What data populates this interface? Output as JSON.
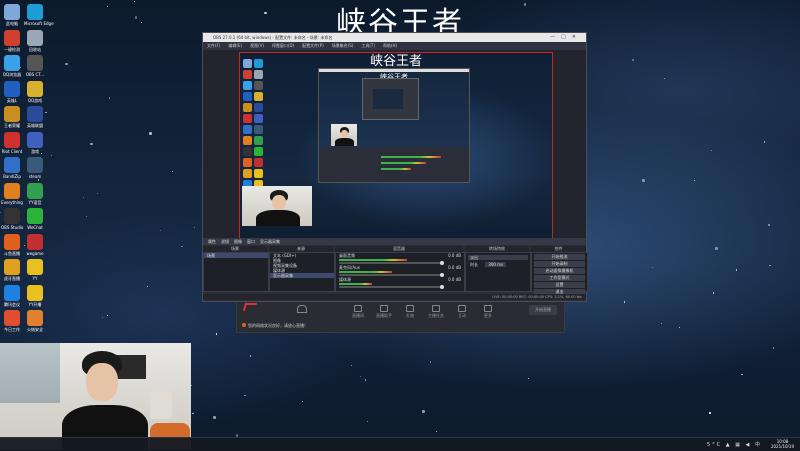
{
  "page_title": "峡谷王者",
  "desktop_icons": [
    {
      "label": "此电脑",
      "color": "#7fa7d8",
      "icon": "computer-icon"
    },
    {
      "label": "Microsoft Edge",
      "color": "#1f9bd8",
      "icon": "edge-icon"
    },
    {
      "label": "一键检测",
      "color": "#d04030",
      "icon": "tool-icon"
    },
    {
      "label": "回收站",
      "color": "#9aa7b4",
      "icon": "recycle-bin-icon"
    },
    {
      "label": "QQ浏览器",
      "color": "#3aa0e8",
      "icon": "qq-browser-icon"
    },
    {
      "label": "OBS CT...",
      "color": "#555",
      "icon": "obs-icon"
    },
    {
      "label": "英雄L",
      "color": "#2060c0",
      "icon": "game-icon"
    },
    {
      "label": "QQ游戏",
      "color": "#d8b030",
      "icon": "qq-game-icon"
    },
    {
      "label": "王者荣耀",
      "color": "#c89020",
      "icon": "game-icon"
    },
    {
      "label": "英雄联盟",
      "color": "#2a4a9a",
      "icon": "lol-icon"
    },
    {
      "label": "Riot Client",
      "color": "#d03030",
      "icon": "riot-icon"
    },
    {
      "label": "游戏",
      "color": "#4060c0",
      "icon": "game-icon"
    },
    {
      "label": "BandiZip",
      "color": "#3070c8",
      "icon": "zip-icon"
    },
    {
      "label": "steam",
      "color": "#3a5a7a",
      "icon": "steam-icon"
    },
    {
      "label": "Everything",
      "color": "#e08020",
      "icon": "search-icon"
    },
    {
      "label": "YY语音",
      "color": "#30a050",
      "icon": "yy-icon"
    },
    {
      "label": "OBS Studio",
      "color": "#333",
      "icon": "obs-icon"
    },
    {
      "label": "WeChat",
      "color": "#2db33a",
      "icon": "wechat-icon"
    },
    {
      "label": "斗鱼直播",
      "color": "#e06020",
      "icon": "douyu-icon"
    },
    {
      "label": "wegame",
      "color": "#c03030",
      "icon": "wegame-icon"
    },
    {
      "label": "虎牙直播",
      "color": "#e0a020",
      "icon": "huya-icon"
    },
    {
      "label": "YY",
      "color": "#e8c020",
      "icon": "yy-icon"
    },
    {
      "label": "腾讯会议",
      "color": "#2080e0",
      "icon": "meeting-icon"
    },
    {
      "label": "YY开播",
      "color": "#e8c020",
      "icon": "yy-icon"
    },
    {
      "label": "今日工作",
      "color": "#e05030",
      "icon": "office-icon"
    },
    {
      "label": "火绒安全",
      "color": "#e08030",
      "icon": "security-icon"
    }
  ],
  "obs": {
    "title": "OBS 27.0.1 (64 bit, windows) - 配置文件: 未命名 - 场景: 未命名",
    "menu": [
      "文件(F)",
      "编辑(E)",
      "视图(V)",
      "停靠窗口(D)",
      "配置文件(P)",
      "场景集合(S)",
      "工具(T)",
      "帮助(H)"
    ],
    "preview_title": "峡谷王者",
    "source_bar": [
      "属性",
      "滤镜",
      "图像",
      "窗口",
      "显示器采集"
    ],
    "docks": {
      "scenes": "场景",
      "sources": "来源",
      "mixer": "混音器",
      "transitions": "转场特效",
      "controls": "控件"
    },
    "sources": [
      "文本 (GDI+)",
      "图像",
      "视频采集设备",
      "媒体源",
      "显示器采集"
    ],
    "mixer": [
      {
        "name": "桌面音频",
        "db": "0.0 dB",
        "level": 0.62
      },
      {
        "name": "麦克风/Aux",
        "db": "0.0 dB",
        "level": 0.48
      },
      {
        "name": "媒体源",
        "db": "0.0 dB",
        "level": 0.3
      }
    ],
    "transition": {
      "type": "淡出",
      "duration_label": "时长",
      "duration": "300 ms"
    },
    "controls": [
      "开始推流",
      "开始录制",
      "启动虚拟摄像机",
      "工作室模式",
      "设置",
      "退出"
    ],
    "status": "LIVE: 00:00:00  REC: 00:00:00  CPU: 2.1%, 60.00 fps"
  },
  "win2": {
    "buttons": [
      "直播间",
      "直播助手",
      "礼物",
      "主播任务",
      "互动",
      "更多"
    ],
    "start_button": "开始直播",
    "notice": "您的网络状况良好，请放心直播！"
  },
  "taskbar": {
    "time": "10:08",
    "date": "2021/10/19",
    "lang": "中",
    "temp": "5°C"
  }
}
